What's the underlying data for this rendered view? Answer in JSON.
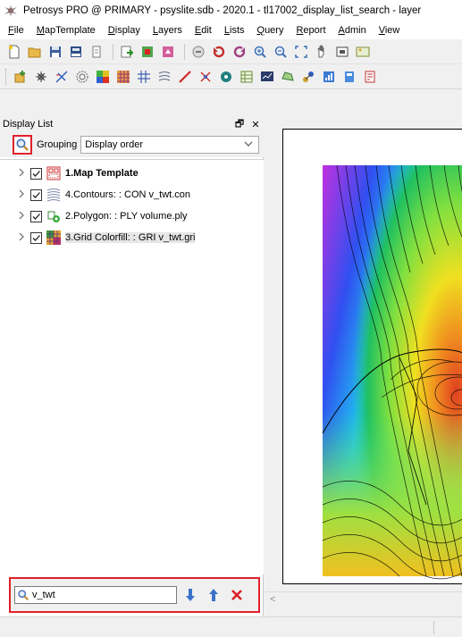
{
  "window": {
    "title": "Petrosys PRO @ PRIMARY - psyslite.sdb - 2020.1 - tl17002_display_list_search - layer"
  },
  "menu": [
    {
      "label": "File"
    },
    {
      "label": "MapTemplate"
    },
    {
      "label": "Display"
    },
    {
      "label": "Layers"
    },
    {
      "label": "Edit"
    },
    {
      "label": "Lists"
    },
    {
      "label": "Query"
    },
    {
      "label": "Report"
    },
    {
      "label": "Admin"
    },
    {
      "label": "View"
    }
  ],
  "display_list": {
    "panel_title": "Display List",
    "float_glyph": "🗗",
    "close_glyph": "✕",
    "grouping_label": "Grouping",
    "grouping_value": "Display order",
    "layers": [
      {
        "label": "1.Map Template",
        "icon": "map-template-icon",
        "checked": true,
        "bold": true
      },
      {
        "label": "4.Contours: : CON v_twt.con",
        "icon": "contours-icon",
        "checked": true,
        "bold": false
      },
      {
        "label": "2.Polygon: : PLY volume.ply",
        "icon": "polygon-icon",
        "checked": true,
        "bold": false
      },
      {
        "label": "3.Grid Colorfill: : GRI v_twt.gri",
        "icon": "grid-colorfill-icon",
        "checked": true,
        "bold": false
      }
    ],
    "search": {
      "value": "v_twt"
    }
  },
  "map": {
    "scroll_left_glyph": "<"
  },
  "colors": {
    "highlight": "#e0202a",
    "selection": "#e6e6e6"
  }
}
